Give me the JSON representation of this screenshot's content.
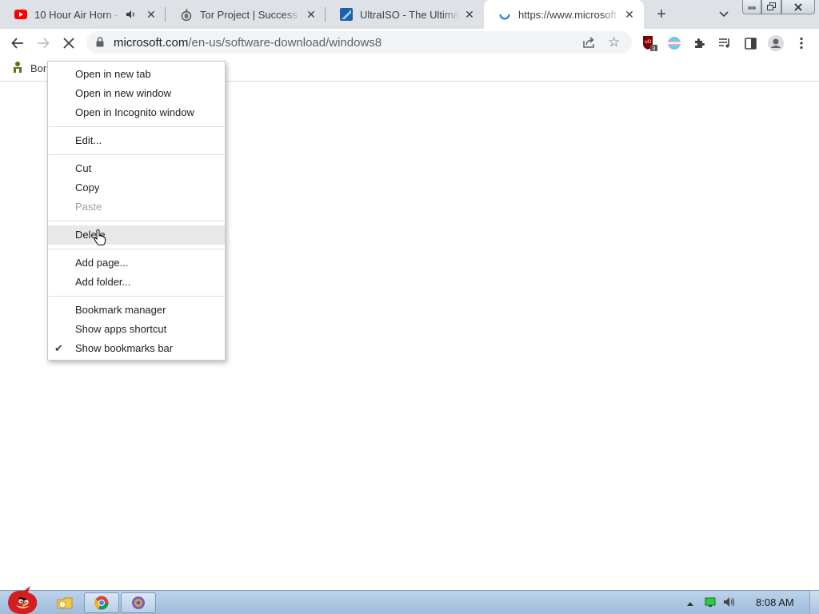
{
  "tabs": [
    {
      "title": "10 Hour Air Horn -",
      "favicon": "youtube-icon",
      "audio": true
    },
    {
      "title": "Tor Project | Success",
      "favicon": "tor-onion-icon"
    },
    {
      "title": "UltraISO - The Ultimate",
      "favicon": "ultraiso-icon"
    },
    {
      "title": "https://www.microsoft.co",
      "favicon": "loading-spinner-icon",
      "active": true
    }
  ],
  "toolbar": {
    "url_host": "microsoft.com",
    "url_path": "/en-us/software-download/windows8",
    "extension_badge": "3"
  },
  "bookmarks_bar": {
    "item_label": "Bor"
  },
  "context_menu": {
    "items": [
      {
        "label": "Open in new tab"
      },
      {
        "label": "Open in new window"
      },
      {
        "label": "Open in Incognito window"
      },
      {
        "label": "Edit..."
      },
      {
        "label": "Cut"
      },
      {
        "label": "Copy"
      },
      {
        "label": "Paste",
        "disabled": true
      },
      {
        "label": "Delete",
        "hovered": true
      },
      {
        "label": "Add page..."
      },
      {
        "label": "Add folder..."
      },
      {
        "label": "Bookmark manager"
      },
      {
        "label": "Show apps shortcut"
      },
      {
        "label": "Show bookmarks bar",
        "checked": true
      }
    ]
  },
  "taskbar": {
    "clock": "8:08 AM"
  },
  "colors": {
    "tabstrip": "#dee1e6",
    "loading_blue": "#1a73e8",
    "taskbar": "#bcd3ea"
  }
}
